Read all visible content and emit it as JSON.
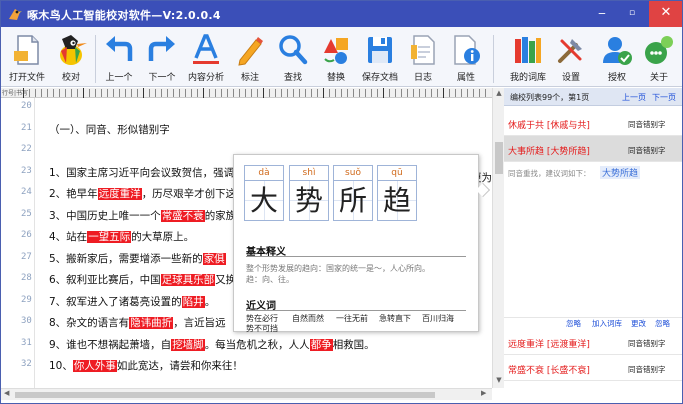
{
  "window": {
    "title": "啄木鸟人工智能校对软件—V:2.0.0.4",
    "min_label": "‒",
    "max_label": "▫",
    "close_label": "✕"
  },
  "toolbar": {
    "items": [
      {
        "label": "打开文件",
        "icon": "open-file-icon"
      },
      {
        "label": "校对",
        "icon": "woodpecker-icon"
      },
      {
        "label": "上一个",
        "icon": "arrow-back-icon"
      },
      {
        "label": "下一个",
        "icon": "arrow-forward-icon"
      },
      {
        "label": "内容分析",
        "icon": "text-analysis-icon"
      },
      {
        "label": "标注",
        "icon": "pencil-icon"
      },
      {
        "label": "查找",
        "icon": "search-icon"
      },
      {
        "label": "替换",
        "icon": "replace-icon"
      },
      {
        "label": "保存文档",
        "icon": "save-icon"
      },
      {
        "label": "日志",
        "icon": "log-icon"
      },
      {
        "label": "属性",
        "icon": "properties-icon"
      },
      {
        "label": "我的词库",
        "icon": "library-icon"
      },
      {
        "label": "设置",
        "icon": "settings-icon"
      },
      {
        "label": "授权",
        "icon": "authorize-icon"
      },
      {
        "label": "关于",
        "icon": "about-icon"
      }
    ]
  },
  "ruler": {
    "tag": "行号|书写"
  },
  "editor": {
    "lines": [
      {
        "num": "20",
        "parts": []
      },
      {
        "num": "21",
        "parts": [
          {
            "t": "（一）、同音、形似错别字",
            "h": false
          }
        ]
      },
      {
        "num": "22",
        "parts": []
      },
      {
        "num": "23",
        "parts": [
          {
            "t": "1、国家主席习近平向会议致贺信，强调",
            "h": false
          }
        ]
      },
      {
        "num": "24",
        "parts": [
          {
            "t": "2、艳早年",
            "h": false
          },
          {
            "t": "远度重洋",
            "h": true
          },
          {
            "t": "，历尽艰辛才创下这",
            "h": false
          }
        ]
      },
      {
        "num": "25",
        "parts": [
          {
            "t": "3、中国历史上唯一一个",
            "h": false
          },
          {
            "t": "常盛不衰",
            "h": true
          },
          {
            "t": "的家族",
            "h": false
          }
        ]
      },
      {
        "num": "26",
        "parts": [
          {
            "t": "4、站在",
            "h": false
          },
          {
            "t": "一望五际",
            "h": true
          },
          {
            "t": "的大草原上。",
            "h": false
          }
        ]
      },
      {
        "num": "27",
        "parts": [
          {
            "t": "5、搬新家后，需要增添一些新的",
            "h": false
          },
          {
            "t": "家俱",
            "h": true
          }
        ]
      },
      {
        "num": "28",
        "parts": [
          {
            "t": "6、叙利亚比赛后，中国",
            "h": false
          },
          {
            "t": "足球具乐部",
            "h": true
          },
          {
            "t": "又换",
            "h": false
          }
        ]
      },
      {
        "num": "29",
        "parts": [
          {
            "t": "7、叙军进入了诸葛亮设置的",
            "h": false
          },
          {
            "t": "陷井",
            "h": true
          },
          {
            "t": "。",
            "h": false
          }
        ]
      },
      {
        "num": "30",
        "parts": [
          {
            "t": "8、杂文的语言有",
            "h": false
          },
          {
            "t": "隐讳曲折",
            "h": true
          },
          {
            "t": "，言近旨远",
            "h": false
          }
        ]
      },
      {
        "num": "31",
        "parts": [
          {
            "t": "9、谁也不想",
            "h": false
          },
          {
            "t": "祸起",
            "h": false
          },
          {
            "t": "萧墙，自",
            "h": false
          },
          {
            "t": "挖墙脚",
            "h": true
          },
          {
            "t": "。每当危机之秋，人人",
            "h": false
          },
          {
            "t": "都争",
            "h": true
          },
          {
            "t": "相救国。",
            "h": false
          }
        ]
      },
      {
        "num": "32",
        "parts": [
          {
            "t": "10、",
            "h": false
          },
          {
            "t": "你人外事",
            "h": true
          },
          {
            "t": "如此宽达，请尝和你来往！",
            "h": false
          }
        ]
      }
    ],
    "line24_tail": "更为"
  },
  "popup": {
    "chars": [
      {
        "py": "dà",
        "ch": "大"
      },
      {
        "py": "shì",
        "ch": "势"
      },
      {
        "py": "suǒ",
        "ch": "所"
      },
      {
        "py": "qū",
        "ch": "趋"
      }
    ],
    "basic_title": "基本释义",
    "basic_text_1": "整个形势发展的趋向：国家的统一是～，人心所向。",
    "basic_text_2": "趋：向、往。",
    "syn_title": "近义词",
    "synonyms": [
      "势在必行",
      "自然而然",
      "一往无前",
      "急转直下",
      "百川归海",
      "势不可挡"
    ]
  },
  "side": {
    "header": "编校列表99个，第1页",
    "prev": "上一页",
    "next": "下一页",
    "items": [
      {
        "word": "休戚于共 [休戚与共]",
        "type": "同音错别字",
        "selected": false
      },
      {
        "word": "大事所趋 [大势所趋]",
        "type": "同音错别字",
        "selected": true
      }
    ],
    "suggest_label": "同音重找，建议词如下：",
    "suggest_value": "大势所趋",
    "actions": [
      "忽略",
      "加入词库",
      "更改",
      "忽略"
    ],
    "items_bottom": [
      {
        "word": "远度重洋 [远渡重洋]",
        "type": "同音错别字"
      },
      {
        "word": "常盛不衰 [长盛不衰]",
        "type": "同音错别字"
      }
    ]
  },
  "colors": {
    "titlebar": "#3b4fb8",
    "error": "#ee1c23",
    "link": "#1e4fd8"
  }
}
